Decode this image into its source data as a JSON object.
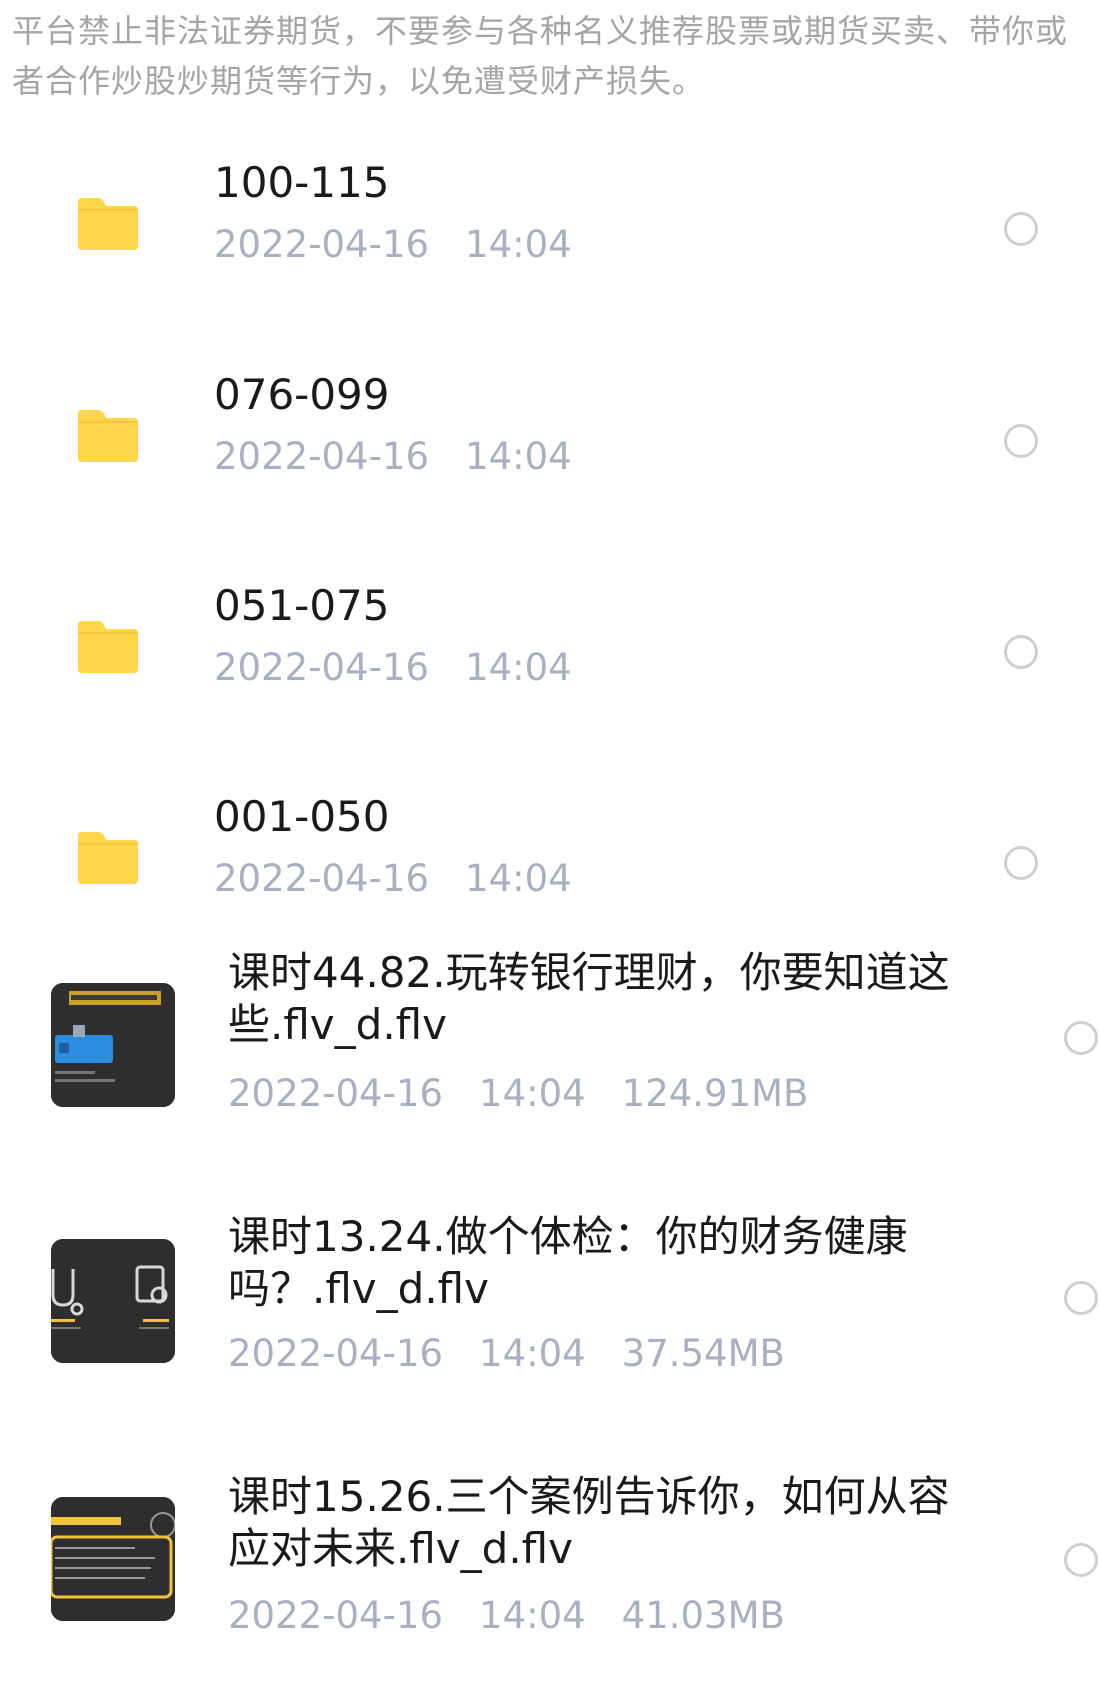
{
  "notice": "平台禁止非法证券期货，不要参与各种名义推荐股票或期货买卖、带你或者合作炒股炒期货等行为，以免遭受财产损失。",
  "folders": [
    {
      "name": "100-115",
      "date": "2022-04-16",
      "time": "14:04"
    },
    {
      "name": "076-099",
      "date": "2022-04-16",
      "time": "14:04"
    },
    {
      "name": "051-075",
      "date": "2022-04-16",
      "time": "14:04"
    },
    {
      "name": "001-050",
      "date": "2022-04-16",
      "time": "14:04"
    }
  ],
  "files": [
    {
      "name": "课时44.82.玩转银行理财，你要知道这些.flv_d.flv",
      "date": "2022-04-16",
      "time": "14:04",
      "size": "124.91MB",
      "thumb_icon": "bank-card-thumbnail"
    },
    {
      "name": "课时13.24.做个体检：你的财务健康吗？.flv_d.flv",
      "date": "2022-04-16",
      "time": "14:04",
      "size": "37.54MB",
      "thumb_icon": "health-check-thumbnail"
    },
    {
      "name": "课时15.26.三个案例告诉你，如何从容应对未来.flv_d.flv",
      "date": "2022-04-16",
      "time": "14:04",
      "size": "41.03MB",
      "thumb_icon": "case-study-thumbnail"
    }
  ],
  "colors": {
    "folder": "#FDD64A",
    "folder_tab": "#F7C93A",
    "meta": "#A8B0C2"
  }
}
